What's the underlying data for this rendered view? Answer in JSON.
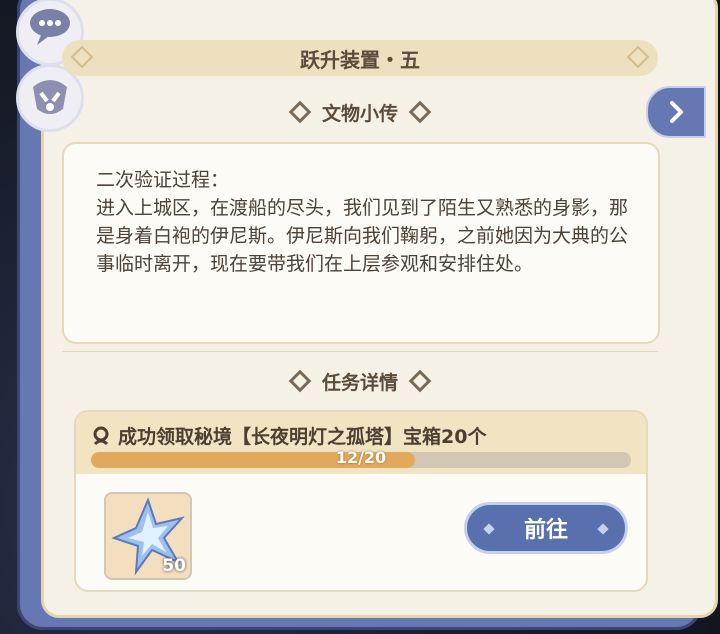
{
  "header": {
    "title": "跃升装置・五"
  },
  "lore": {
    "heading": "文物小传",
    "text": "二次验证过程：\n进入上城区，在渡船的尽头，我们见到了陌生又熟悉的身影，那是身着白袍的伊尼斯。伊尼斯向我们鞠躬，之前她因为大典的公事临时离开，现在要带我们在上层参观和安排住处。"
  },
  "task": {
    "heading": "任务详情",
    "title": "成功领取秘境【长夜明灯之孤塔】宝箱20个",
    "progress_text": "12/20",
    "progress_fraction": 0.6,
    "reward_count": "50",
    "go_label": "前往"
  },
  "icons": {
    "chat": "chat-bubble-icon",
    "badge": "paimon-badge-icon",
    "next": "chevron-right-icon",
    "task": "quest-icon",
    "reward": "star-crystal-icon"
  },
  "colors": {
    "frame": "#6677b4",
    "panel": "#f6f1e6",
    "accent_button": "#5970ae",
    "progress_fill": "#e3a95b"
  }
}
